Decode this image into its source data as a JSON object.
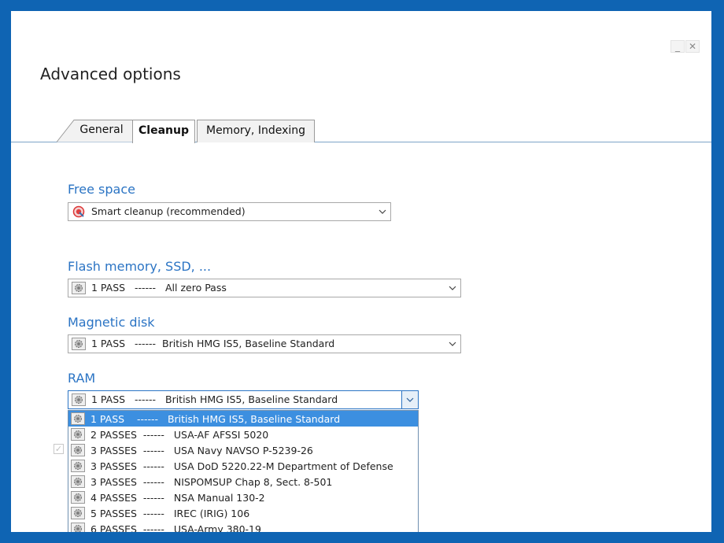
{
  "window": {
    "title": "Advanced options",
    "minimize_glyph": "_",
    "close_glyph": "✕"
  },
  "tabs": [
    {
      "label": "General"
    },
    {
      "label": "Cleanup",
      "active": true
    },
    {
      "label": "Memory, Indexing"
    }
  ],
  "free_space": {
    "label": "Free space",
    "value": "Smart cleanup (recommended)",
    "icon": "smart-cleanup-icon"
  },
  "flash": {
    "label": "Flash memory, SSD, ...",
    "value": "1 PASS   ------   All zero Pass",
    "icon": "gear-icon"
  },
  "magnetic": {
    "label": "Magnetic disk",
    "value": "1 PASS   ------  British HMG IS5, Baseline Standard",
    "icon": "gear-icon"
  },
  "ram": {
    "label": "RAM",
    "value": "1 PASS   ------   British HMG IS5, Baseline Standard",
    "icon": "gear-icon",
    "options": [
      "1 PASS    ------   British HMG IS5, Baseline Standard",
      "2 PASSES  ------   USA-AF AFSSI 5020",
      "3 PASSES  ------   USA Navy NAVSO P-5239-26",
      "3 PASSES  ------   USA DoD 5220.22-M Department of Defense",
      "3 PASSES  ------   NISPOMSUP Chap 8, Sect. 8-501",
      "4 PASSES  ------   NSA Manual 130-2",
      "5 PASSES  ------   IREC (IRIG) 106",
      "6 PASSES  ------   USA-Army 380-19"
    ],
    "selected_index": 0
  },
  "colors": {
    "desktop": "#0f64b3",
    "accent": "#2b74c4",
    "selection": "#3c8fe0"
  }
}
